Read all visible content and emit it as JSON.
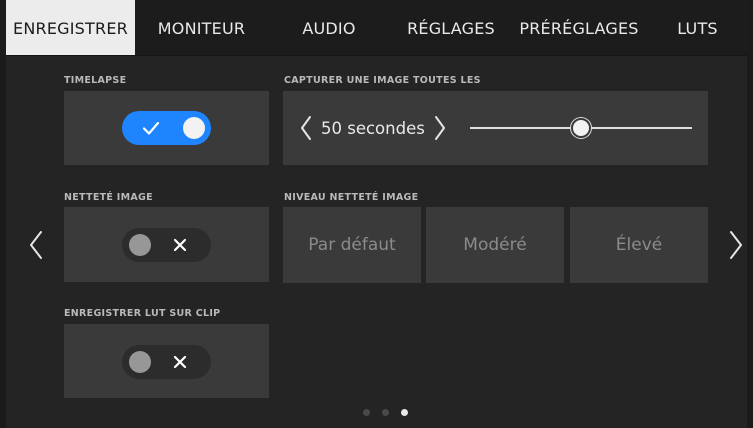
{
  "tabs": [
    {
      "label": "ENREGISTRER",
      "active": true
    },
    {
      "label": "MONITEUR",
      "active": false
    },
    {
      "label": "AUDIO",
      "active": false
    },
    {
      "label": "RÉGLAGES",
      "active": false
    },
    {
      "label": "PRÉRÉGLAGES",
      "active": false
    },
    {
      "label": "LUTS",
      "active": false
    }
  ],
  "timelapse": {
    "label": "TIMELAPSE",
    "enabled": true
  },
  "capture": {
    "label": "CAPTURER UNE IMAGE TOUTES LES",
    "value_text": "50 secondes",
    "slider_fraction": 0.5
  },
  "sharpness": {
    "label": "NETTETÉ IMAGE",
    "enabled": false
  },
  "sharpness_level": {
    "label": "NIVEAU NETTETÉ IMAGE",
    "options": [
      "Par défaut",
      "Modéré",
      "Élevé"
    ]
  },
  "record_lut": {
    "label": "ENREGISTRER LUT SUR CLIP",
    "enabled": false
  },
  "pagination": {
    "total": 3,
    "current": 3
  },
  "colors": {
    "accent": "#1f85ff",
    "tile": "#3a3a3a",
    "background": "#242424"
  },
  "icons": {
    "check": "check-icon",
    "x": "x-icon",
    "left_chevron": "chevron-left-icon",
    "right_chevron": "chevron-right-icon"
  }
}
